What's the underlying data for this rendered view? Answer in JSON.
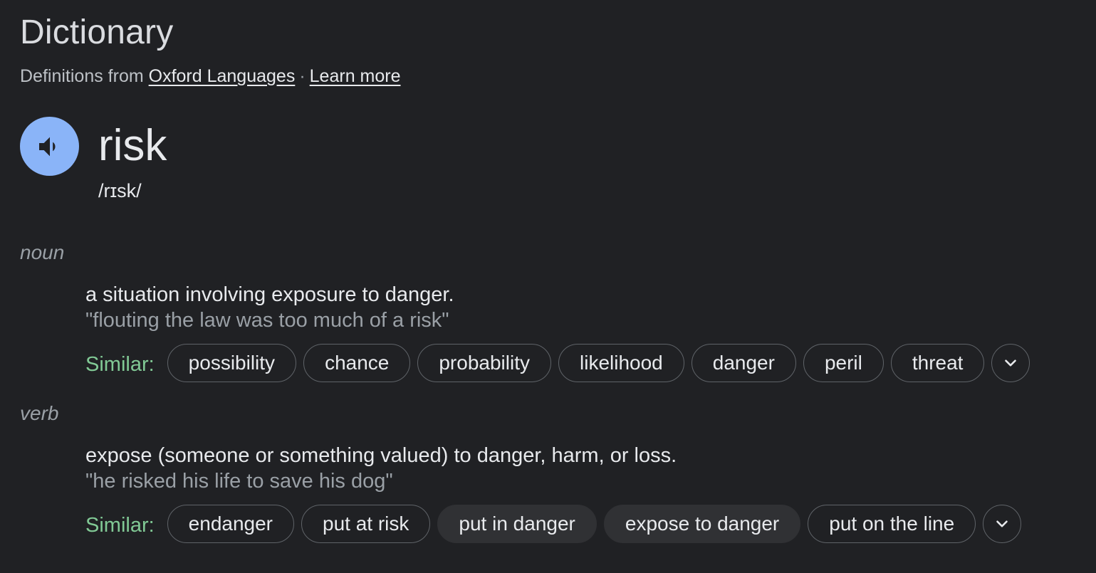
{
  "header": {
    "title": "Dictionary",
    "source_prefix": "Definitions from",
    "source_link": "Oxford Languages",
    "separator": "·",
    "learn_more": "Learn more"
  },
  "entry": {
    "word": "risk",
    "phonetic": "/rɪsk/",
    "speaker_icon": "volume-icon",
    "accent_color": "#8ab4f8"
  },
  "senses": [
    {
      "part_of_speech": "noun",
      "definition": "a situation involving exposure to danger.",
      "example": "\"flouting the law was too much of a risk\"",
      "similar_label": "Similar:",
      "similar": [
        "possibility",
        "chance",
        "probability",
        "likelihood",
        "danger",
        "peril",
        "threat"
      ]
    },
    {
      "part_of_speech": "verb",
      "definition": "expose (someone or something valued) to danger, harm, or loss.",
      "example": "\"he risked his life to save his dog\"",
      "similar_label": "Similar:",
      "similar": [
        "endanger",
        "put at risk",
        "put in danger",
        "expose to danger",
        "put on the line"
      ]
    }
  ],
  "colors": {
    "background": "#202124",
    "similar_label": "#81c995",
    "muted_text": "#9aa0a6"
  }
}
